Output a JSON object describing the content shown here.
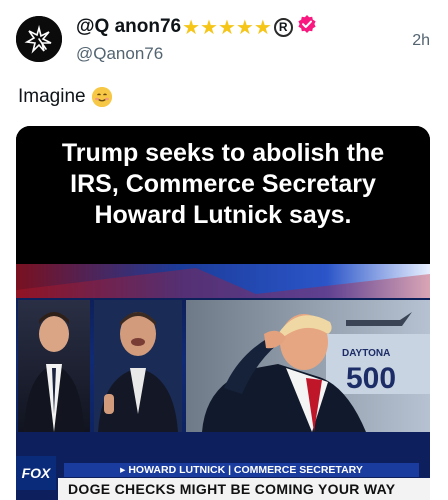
{
  "post": {
    "display_name": "@Q anon76",
    "stars": "★★★★★",
    "registered_symbol": "R",
    "handle": "@Qanon76",
    "time": "2h",
    "text": "Imagine"
  },
  "media": {
    "headline_lines": [
      "Trump seeks to abolish the",
      "IRS, Commerce Secretary",
      "Howard Lutnick says."
    ],
    "channel_logo": "FOX",
    "lower_third": "▸ HOWARD LUTNICK | COMMERCE SECRETARY",
    "ticker": "DOGE CHECKS MIGHT BE COMING YOUR WAY"
  },
  "colors": {
    "verified_badge": "#f91880",
    "stars": "#f5c518",
    "text_primary": "#0f1419",
    "text_secondary": "#536471"
  },
  "icons": {
    "verified": "verified-badge-icon",
    "emoji": "smiling-face-emoji-icon"
  }
}
